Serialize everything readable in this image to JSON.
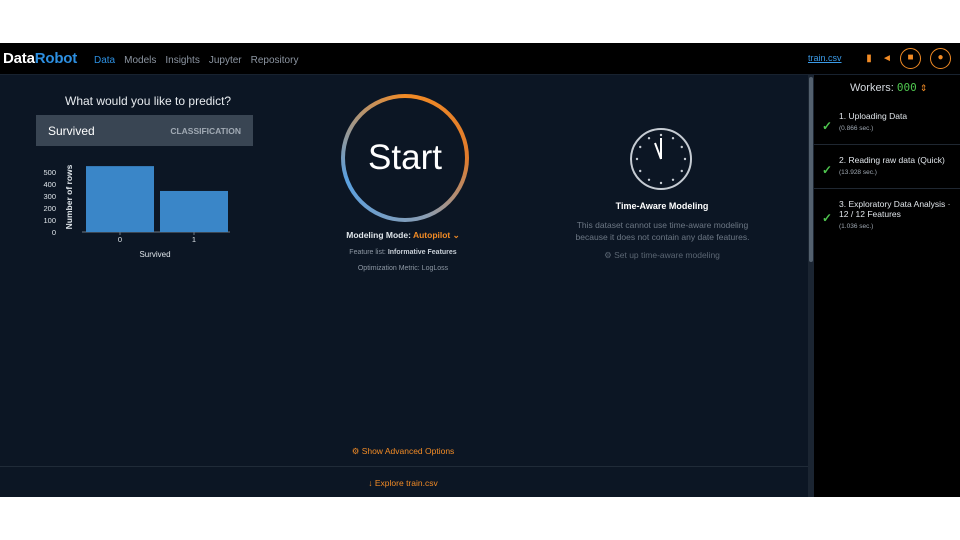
{
  "app": {
    "logo_part1": "Data",
    "logo_part2": "Robot",
    "nav": [
      "Data",
      "Models",
      "Insights",
      "Jupyter",
      "Repository"
    ],
    "dataset_link": "train.csv",
    "accent": "#f28b25",
    "brand_blue": "#2d8fe0"
  },
  "prediction": {
    "question": "What would you like to predict?",
    "target": "Survived",
    "target_type": "CLASSIFICATION"
  },
  "histogram": {
    "categories": [
      "0",
      "1"
    ],
    "values": [
      549,
      342
    ],
    "y_ticks": [
      "500",
      "400",
      "300",
      "200",
      "100",
      "0"
    ],
    "y_max": 600,
    "x_label": "Survived",
    "y_label": "Number of rows"
  },
  "start": {
    "label": "Start",
    "mode_label": "Modeling Mode:",
    "mode_value": "Autopilot",
    "feature_label": "Feature list:",
    "feature_value": "Informative Features",
    "metric_label": "Optimization Metric:",
    "metric_value": "LogLoss"
  },
  "time_aware": {
    "title": "Time-Aware Modeling",
    "description": "This dataset cannot use time-aware modeling because it does not contain any date features.",
    "setup_link": "Set up time-aware modeling"
  },
  "footer": {
    "advanced_options": "Show Advanced Options",
    "explore": "Explore train.csv"
  },
  "workers": {
    "label": "Workers:",
    "count": "000"
  },
  "steps": [
    {
      "label": "1. Uploading Data",
      "time": "(0.866 sec.)"
    },
    {
      "label": "2. Reading raw data (Quick)",
      "time": "(13.928 sec.)"
    },
    {
      "label": "3. Exploratory Data Analysis ·",
      "sub": "12 / 12 Features",
      "time": "(1.036 sec.)"
    }
  ]
}
